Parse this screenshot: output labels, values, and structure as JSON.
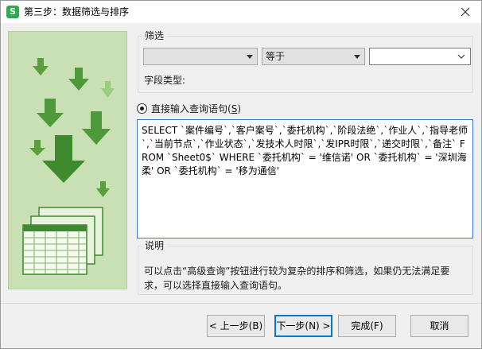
{
  "window": {
    "title": "第三步：数据筛选与排序",
    "app_icon_letter": "S",
    "close_icon": "close-icon"
  },
  "filter": {
    "legend": "筛选",
    "field_select_value": "",
    "operator_select_value": "等于",
    "value_combo_value": "",
    "field_type_label": "字段类型:"
  },
  "direct_query": {
    "label": "直接输入查询语句(S)",
    "label_prefix": "直接输入查询语句(",
    "label_accel": "S",
    "label_suffix": ")",
    "selected": true,
    "sql": "SELECT `案件编号`,`客户案号`,`委托机构`,`阶段法绝`,`作业人`,`指导老师`,`当前节点`,`作业状态`,`发技术人时限`,`发IPR时限`,`递交时限`,`备注` FROM `Sheet0$`  WHERE `委托机构` = '维信诺' OR `委托机构` = '深圳海柔' OR `委托机构` = '移为通信'"
  },
  "help": {
    "legend": "说明",
    "text": "可以点击“高级查询”按钮进行较为复杂的排序和筛选，如果仍无法满足要求，可以选择直接输入查询语句。"
  },
  "buttons": {
    "back": "< 上一步(B)",
    "next": "下一步(N) >",
    "finish": "完成(F)",
    "cancel": "取消"
  },
  "colors": {
    "illustration_bg": "#c8e0b3",
    "arrow_dark": "#4e9a3a",
    "arrow_light": "#8cc06f",
    "focus_border": "#0078d7"
  }
}
